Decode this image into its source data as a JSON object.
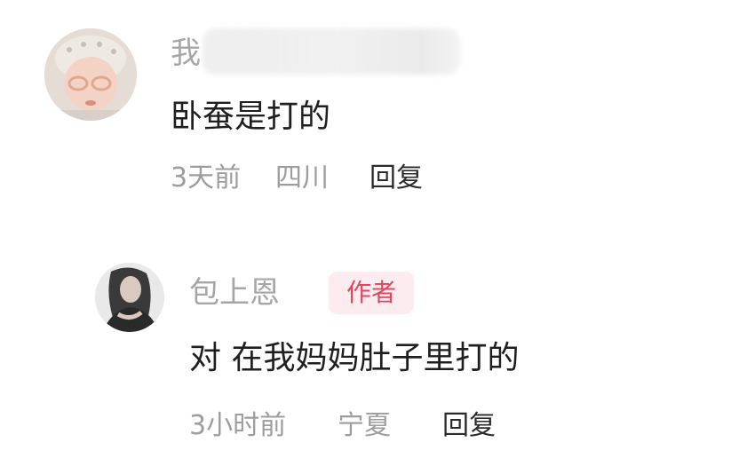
{
  "comments": [
    {
      "username": "我",
      "text": "卧蚕是打的",
      "time": "3天前",
      "location": "四川",
      "reply_label": "回复",
      "avatar_icon": "baby-avatar-photo"
    },
    {
      "username": "包上恩",
      "author_badge": "作者",
      "text": "对 在我妈妈肚子里打的",
      "time": "3小时前",
      "location": "宁夏",
      "reply_label": "回复",
      "avatar_icon": "woman-avatar-photo"
    }
  ],
  "colors": {
    "badge_bg": "#fdecef",
    "badge_text": "#e0465c",
    "meta_text": "#9d9d9d",
    "content_text": "#1f1f1f"
  }
}
